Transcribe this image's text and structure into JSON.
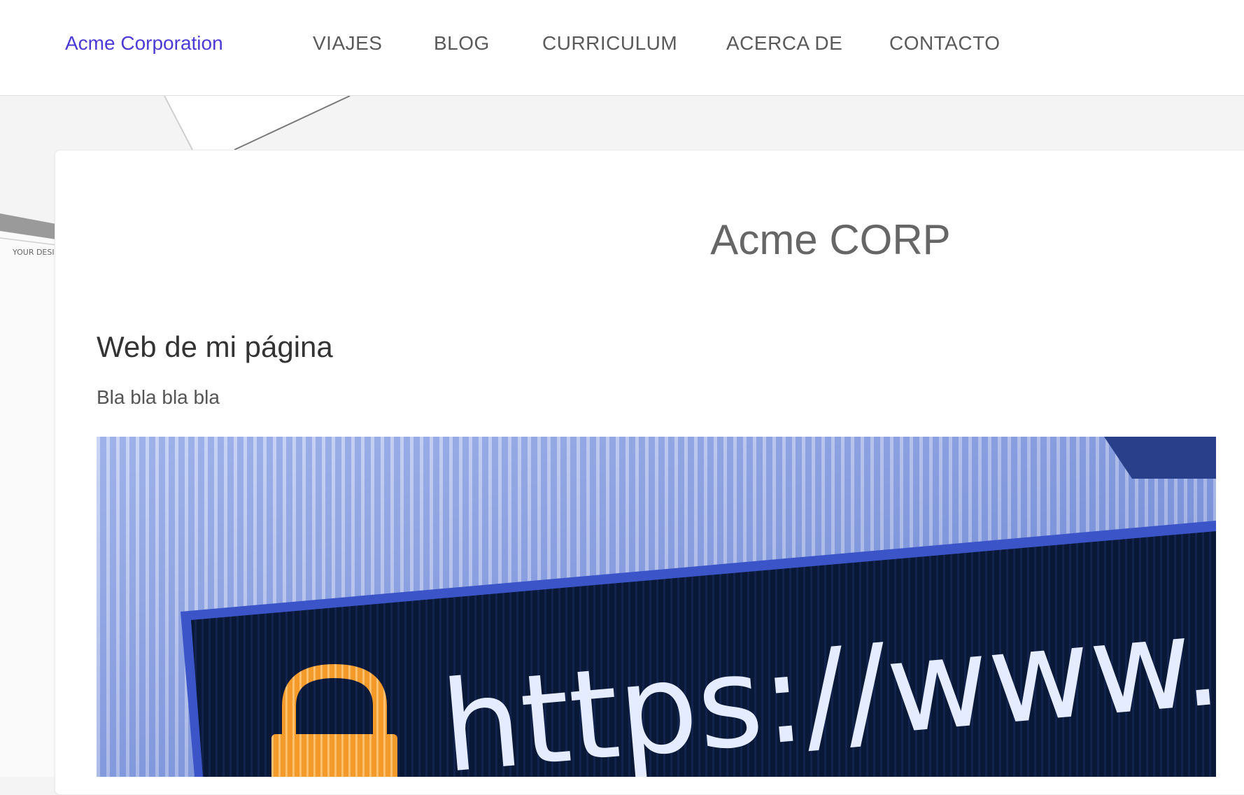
{
  "navbar": {
    "brand": "Acme Corporation",
    "items": [
      "VIAJES",
      "BLOG",
      "CURRICULUM",
      "ACERCA DE",
      "CONTACTO"
    ]
  },
  "background": {
    "paper_text": "YOUR DESI"
  },
  "main": {
    "site_title": "Acme CORP",
    "heading": "Web de mi página",
    "text": "Bla bla bla bla",
    "hero": {
      "url_text": "https://www.ssl",
      "icon": "padlock-icon"
    }
  },
  "colors": {
    "brand": "#4a3ad6",
    "nav_text": "#5a5a5a",
    "heading": "#333333",
    "title": "#666666",
    "hero_blue": "#5f7fd6",
    "hero_dark": "#0a1838",
    "padlock": "#f39a2b"
  }
}
